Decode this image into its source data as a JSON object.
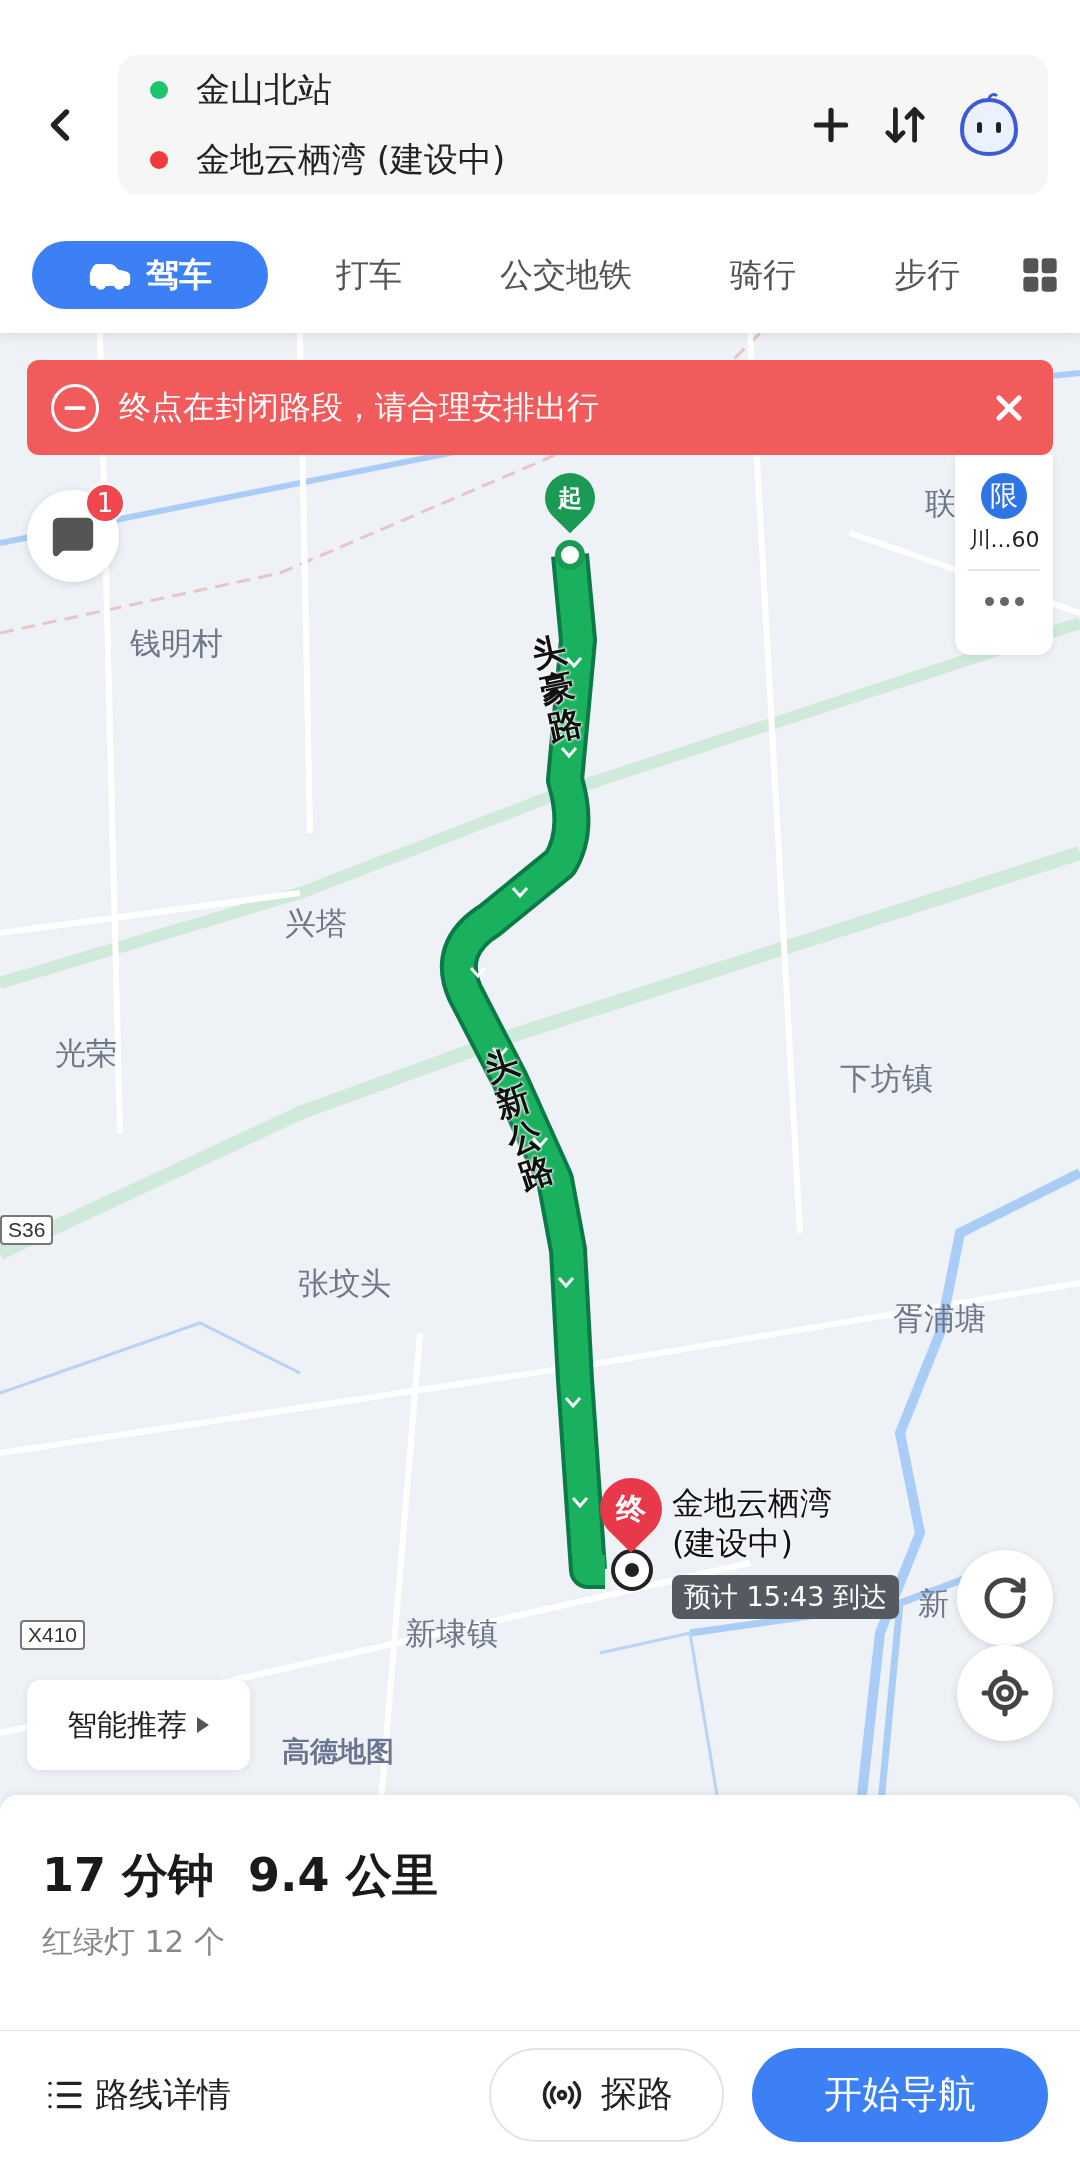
{
  "route_inputs": {
    "start": "金山北站",
    "end": "金地云栖湾 (建设中)"
  },
  "modes": [
    {
      "label": "驾车",
      "selected": true
    },
    {
      "label": "打车",
      "selected": false
    },
    {
      "label": "公交地铁",
      "selected": false
    },
    {
      "label": "骑行",
      "selected": false
    },
    {
      "label": "步行",
      "selected": false
    }
  ],
  "alert": {
    "text": "终点在封闭路段，请合理安排出行"
  },
  "messages_badge": "1",
  "restriction": {
    "icon_text": "限",
    "plate": "川...60"
  },
  "map_labels": [
    "联",
    "钱明村",
    "兴塔",
    "光荣",
    "下坊镇",
    "张坟头",
    "胥浦塘",
    "新埭镇",
    "新"
  ],
  "road_shields": [
    "S36",
    "X410"
  ],
  "road_names": [
    "头豪路",
    "头新公路"
  ],
  "start_pin": "起",
  "end_pin": "终",
  "destination": {
    "name": "金地云栖湾",
    "note": "(建设中)",
    "eta": "预计 15:43 到达"
  },
  "smart_recommend": "智能推荐",
  "map_logo": "高德地图",
  "summary": {
    "duration": "17 分钟",
    "distance": "9.4 公里",
    "traffic_lights": "红绿灯 12 个"
  },
  "actions": {
    "details": "路线详情",
    "explore": "探路",
    "navigate": "开始导航"
  }
}
